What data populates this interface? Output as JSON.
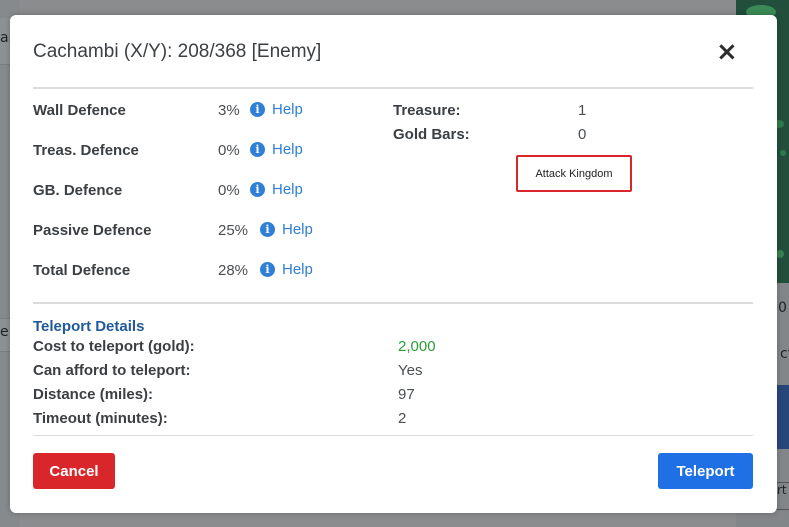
{
  "background": {
    "left_partial_text": "ar",
    "left_partial_text2": "e",
    "right_partial_text": "0",
    "right_partial_text2": "ct",
    "right_partial_button": "rt"
  },
  "modal": {
    "title": "Cachambi (X/Y): 208/368 [Enemy]",
    "close_symbol": "×"
  },
  "defence": {
    "help_label": "Help",
    "rows": [
      {
        "label": "Wall Defence",
        "value": "3%"
      },
      {
        "label": "Treas. Defence",
        "value": "0%"
      },
      {
        "label": "GB. Defence",
        "value": "0%"
      },
      {
        "label": "Passive Defence",
        "value": "25%"
      },
      {
        "label": "Total Defence",
        "value": "28%"
      }
    ]
  },
  "resources": {
    "treasure_label": "Treasure:",
    "treasure_value": "1",
    "gold_bars_label": "Gold Bars:",
    "gold_bars_value": "0",
    "attack_button": "Attack Kingdom"
  },
  "teleport": {
    "section_title": "Teleport Details",
    "cost_label": "Cost to teleport (gold):",
    "cost_value": "2,000",
    "afford_label": "Can afford to teleport:",
    "afford_value": "Yes",
    "distance_label": "Distance (miles):",
    "distance_value": "97",
    "timeout_label": "Timeout (minutes):",
    "timeout_value": "2"
  },
  "footer": {
    "cancel_label": "Cancel",
    "teleport_label": "Teleport"
  },
  "colors": {
    "accent_blue": "#1f6fe5",
    "danger_red": "#d9262b",
    "link_blue": "#2e7fd6",
    "cost_green": "#2a9d3a",
    "section_title_blue": "#1f5b99"
  },
  "icons": {
    "info": "info-icon",
    "close": "close-icon"
  }
}
